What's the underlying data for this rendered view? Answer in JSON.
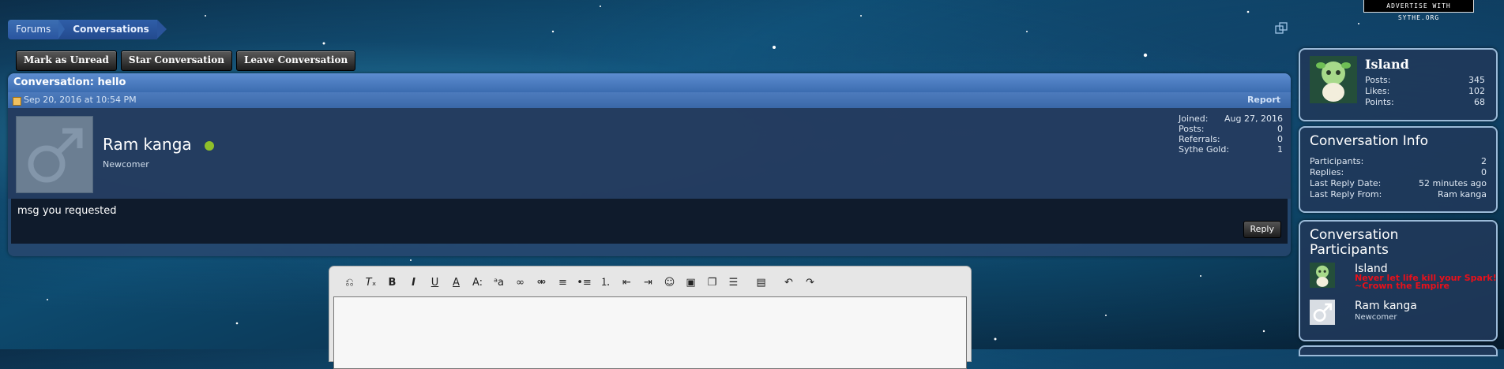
{
  "breadcrumb": {
    "home": "Forums",
    "current": "Conversations"
  },
  "ad_text": "ADVERTISE WITH SYTHE.ORG",
  "actions": {
    "mark_unread": "Mark as Unread",
    "star": "Star Conversation",
    "leave": "Leave Conversation"
  },
  "conversation": {
    "title": "Conversation: hello",
    "date": "Sep 20, 2016 at 10:54 PM",
    "report": "Report",
    "author": {
      "name": "Ram kanga",
      "title": "Newcomer",
      "stats": [
        {
          "label": "Joined:",
          "value": "Aug 27, 2016"
        },
        {
          "label": "Posts:",
          "value": "0"
        },
        {
          "label": "Referrals:",
          "value": "0"
        },
        {
          "label": "Sythe Gold:",
          "value": "1"
        }
      ]
    },
    "message": "msg you requested",
    "reply": "Reply"
  },
  "editor": {
    "tools": [
      "remove-format-icon",
      "clear-format-icon",
      "bold-icon",
      "italic-icon",
      "underline-icon",
      "text-color-icon",
      "font-size-icon",
      "font-family-icon",
      "link-icon",
      "unlink-icon",
      "align-icon",
      "bullet-list-icon",
      "number-list-icon",
      "outdent-icon",
      "indent-icon",
      "smiley-icon",
      "image-icon",
      "media-icon",
      "insert-icon",
      "save-draft-icon",
      "undo-icon",
      "redo-icon"
    ]
  },
  "profile": {
    "name": "Island",
    "stats": [
      {
        "label": "Posts:",
        "value": "345"
      },
      {
        "label": "Likes:",
        "value": "102"
      },
      {
        "label": "Points:",
        "value": "68"
      }
    ]
  },
  "info": {
    "title": "Conversation Info",
    "stats": [
      {
        "label": "Participants:",
        "value": "2"
      },
      {
        "label": "Replies:",
        "value": "0"
      },
      {
        "label": "Last Reply Date:",
        "value": "52 minutes ago"
      },
      {
        "label": "Last Reply From:",
        "value": "Ram kanga"
      }
    ]
  },
  "participants": {
    "title": "Conversation Participants",
    "list": [
      {
        "name": "Island",
        "signature": "Never let life kill your Spark! ~Crown the Empire"
      },
      {
        "name": "Ram kanga",
        "title": "Newcomer"
      }
    ]
  }
}
